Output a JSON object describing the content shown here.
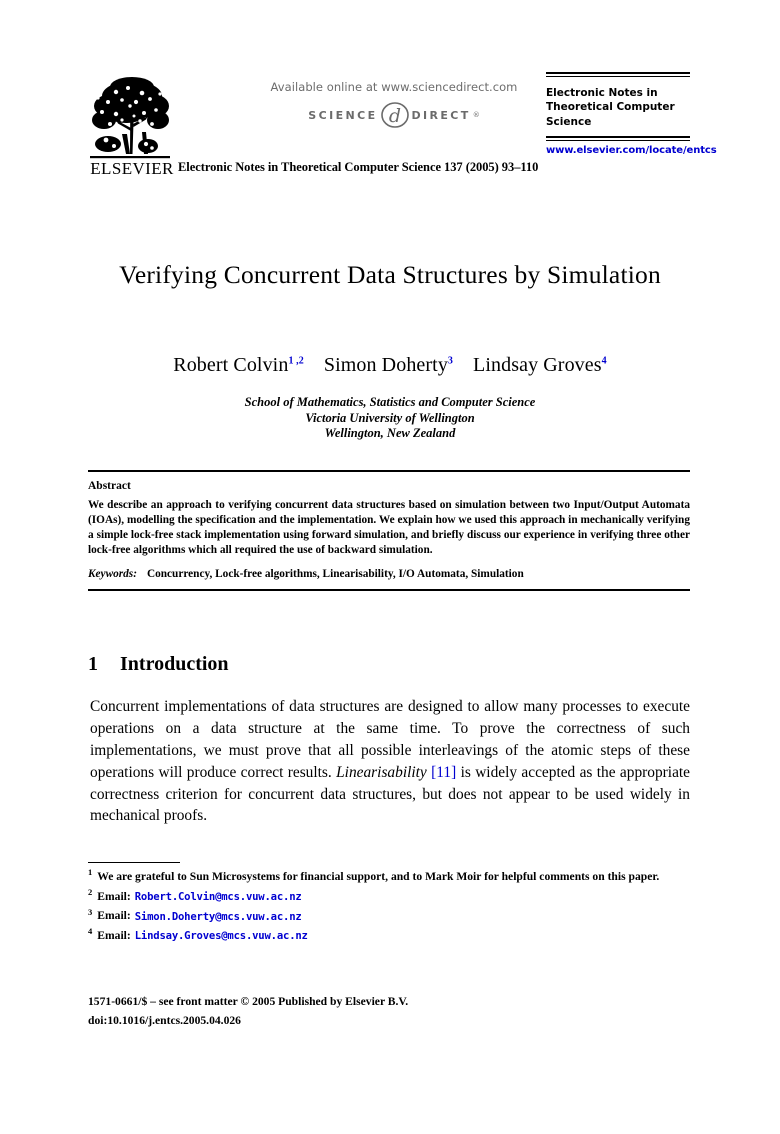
{
  "masthead": {
    "publisher_logo_name": "elsevier-tree-logo",
    "publisher_wordmark": "ELSEVIER",
    "available_online": "Available online at www.sciencedirect.com",
    "sciencedirect_word_left": "SCIENCE",
    "sciencedirect_word_right": "DIRECT",
    "sciencedirect_registered": "®",
    "journal_name": "Electronic Notes in Theoretical Computer Science",
    "journal_url": "www.elsevier.com/locate/entcs",
    "citation": "Electronic Notes in Theoretical Computer Science 137 (2005) 93–110"
  },
  "article": {
    "title": "Verifying Concurrent Data Structures by Simulation",
    "authors": [
      {
        "name": "Robert Colvin",
        "sup": "1 ,2"
      },
      {
        "name": "Simon Doherty",
        "sup": "3"
      },
      {
        "name": "Lindsay Groves",
        "sup": "4"
      }
    ],
    "affiliation": [
      "School of Mathematics, Statistics and Computer Science",
      "Victoria University of Wellington",
      "Wellington, New Zealand"
    ]
  },
  "abstract": {
    "heading": "Abstract",
    "body": "We describe an approach to verifying concurrent data structures based on simulation between two Input/Output Automata (IOAs), modelling the specification and the implementation. We explain how we used this approach in mechanically verifying a simple lock-free stack implementation using forward simulation, and briefly discuss our experience in verifying three other lock-free algorithms which all required the use of backward simulation.",
    "keywords_label": "Keywords:",
    "keywords_value": "Concurrency, Lock-free algorithms, Linearisability, I/O Automata, Simulation"
  },
  "section": {
    "number": "1",
    "title": "Introduction",
    "paragraph_part1": "Concurrent implementations of data structures are designed to allow many processes to execute operations on a data structure at the same time. To prove the correctness of such implementations, we must prove that all possible interleavings of the atomic steps of these operations will produce correct results. ",
    "paragraph_emph": "Linearisability",
    "paragraph_space1": " ",
    "paragraph_bracket_open": "[",
    "paragraph_citation": "11",
    "paragraph_bracket_close": "]",
    "paragraph_part2": " is widely accepted as the appropriate correctness criterion for concurrent data structures, but does not appear to be used widely in mechanical proofs."
  },
  "footnotes": [
    {
      "mark": "1",
      "text": "We are grateful to Sun Microsystems for financial support, and to Mark Moir for helpful comments on this paper.",
      "email": ""
    },
    {
      "mark": "2",
      "text": "Email:",
      "email": "Robert.Colvin@mcs.vuw.ac.nz"
    },
    {
      "mark": "3",
      "text": "Email:",
      "email": "Simon.Doherty@mcs.vuw.ac.nz"
    },
    {
      "mark": "4",
      "text": "Email:",
      "email": "Lindsay.Groves@mcs.vuw.ac.nz"
    }
  ],
  "footer": {
    "copyright": "1571-0661/$ – see front matter © 2005 Published by Elsevier B.V.",
    "doi": "doi:10.1016/j.entcs.2005.04.026"
  },
  "colors": {
    "link_blue": "#0000d0",
    "sciencedirect_gray": "#6b6b6b",
    "text_black": "#000000"
  }
}
